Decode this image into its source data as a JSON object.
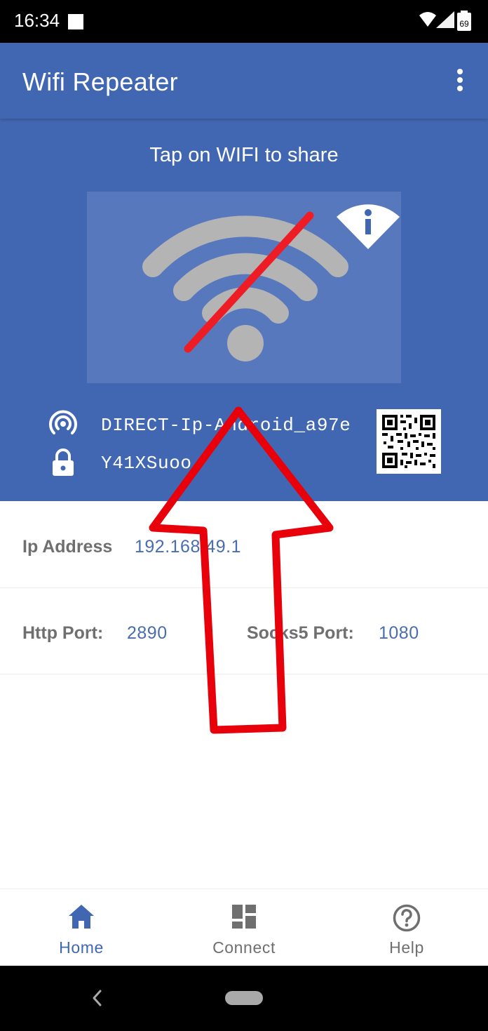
{
  "status_bar": {
    "time": "16:34",
    "battery_level": "69"
  },
  "app_bar": {
    "title": "Wifi Repeater",
    "menu_icon": "more-vert-icon"
  },
  "hero": {
    "hint": "Tap on WIFI to share",
    "wifi_icon": "wifi-off-icon",
    "info_icon": "wifi-info-icon",
    "network_name": "DIRECT-Ip-Android_a97e",
    "password": "Y41XSuoo",
    "network_icon": "hotspot-icon",
    "password_icon": "lock-icon",
    "qr_icon": "qr-code-icon"
  },
  "details": {
    "ip_label": "Ip Address",
    "ip_value": "192.168.49.1",
    "http_label": "Http Port:",
    "http_value": "2890",
    "socks_label": "Socks5 Port:",
    "socks_value": "1080"
  },
  "bottom_nav": {
    "items": [
      {
        "label": "Home",
        "icon": "home-icon",
        "active": true
      },
      {
        "label": "Connect",
        "icon": "dashboard-icon",
        "active": false
      },
      {
        "label": "Help",
        "icon": "help-icon",
        "active": false
      }
    ]
  },
  "colors": {
    "primary": "#4267b2",
    "accent_text": "#4a6cb0",
    "annotation": "#e8000b",
    "inactive": "#6f6f6f"
  }
}
